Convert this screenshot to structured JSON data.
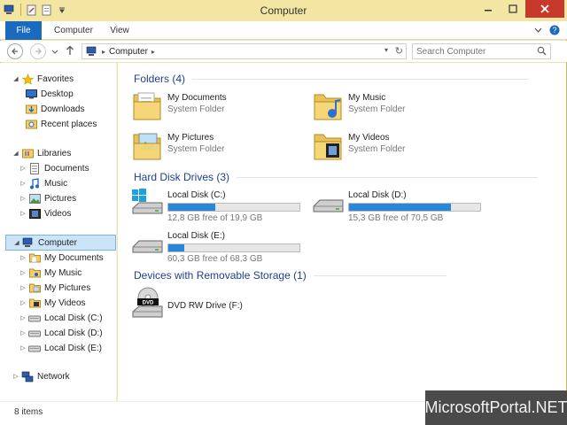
{
  "window": {
    "title": "Computer"
  },
  "ribbon": {
    "tabs": [
      "File",
      "Computer",
      "View"
    ]
  },
  "address": {
    "segments": [
      "Computer"
    ]
  },
  "search": {
    "placeholder": "Search Computer"
  },
  "sidebar": {
    "favorites": {
      "label": "Favorites",
      "items": [
        "Desktop",
        "Downloads",
        "Recent places"
      ]
    },
    "libraries": {
      "label": "Libraries",
      "items": [
        "Documents",
        "Music",
        "Pictures",
        "Videos"
      ]
    },
    "computer": {
      "label": "Computer",
      "items": [
        "My Documents",
        "My Music",
        "My Pictures",
        "My Videos",
        "Local Disk (C:)",
        "Local Disk (D:)",
        "Local Disk (E:)"
      ]
    },
    "network": {
      "label": "Network"
    }
  },
  "groups": {
    "folders": {
      "title": "Folders (4)",
      "items": [
        {
          "name": "My Documents",
          "type": "System Folder"
        },
        {
          "name": "My Music",
          "type": "System Folder"
        },
        {
          "name": "My Pictures",
          "type": "System Folder"
        },
        {
          "name": "My Videos",
          "type": "System Folder"
        }
      ]
    },
    "drives": {
      "title": "Hard Disk Drives (3)",
      "items": [
        {
          "name": "Local Disk (C:)",
          "free": "12,8 GB free of 19,9 GB",
          "used_fraction": 0.36
        },
        {
          "name": "Local Disk (D:)",
          "free": "15,3 GB free of 70,5 GB",
          "used_fraction": 0.78
        },
        {
          "name": "Local Disk (E:)",
          "free": "60,3 GB free of 68,3 GB",
          "used_fraction": 0.12
        }
      ]
    },
    "removable": {
      "title": "Devices with Removable Storage (1)",
      "items": [
        {
          "name": "DVD RW Drive (F:)"
        }
      ]
    }
  },
  "status": {
    "count": "8 items"
  },
  "watermark": "MicrosoftPortal.NET",
  "colors": {
    "accent": "#1a6bbf",
    "frame": "#f2e6a2",
    "group_title": "#1e3f8f",
    "bar_fill": "#2a87d8"
  }
}
